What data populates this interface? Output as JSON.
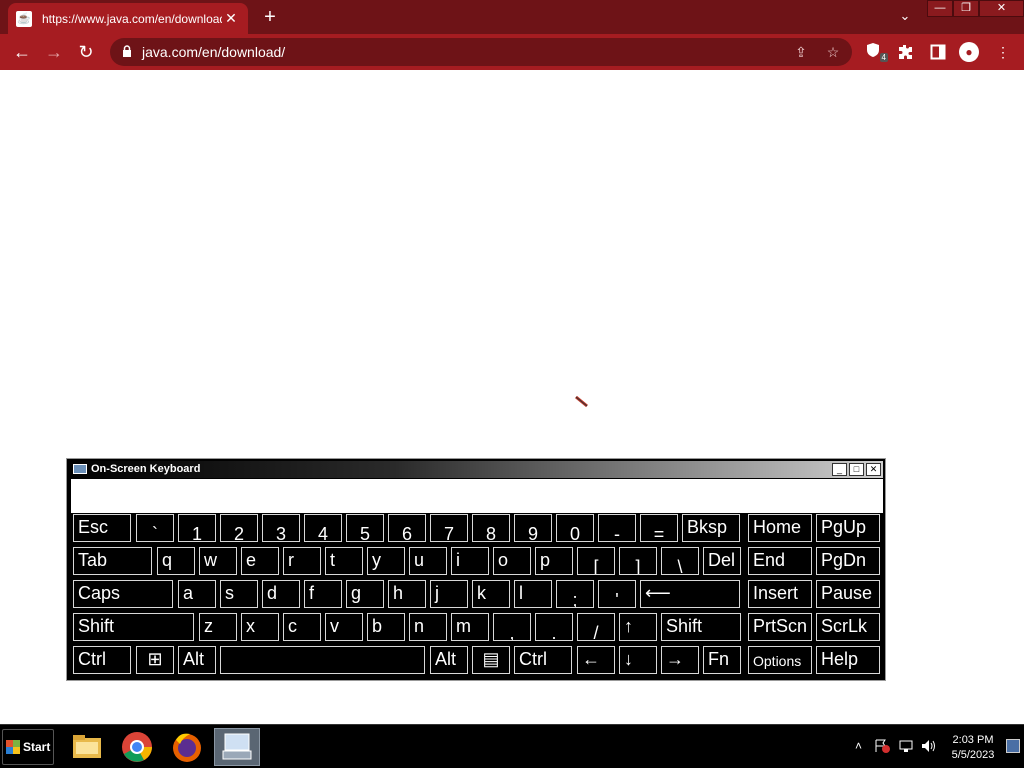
{
  "browser": {
    "tab_title": "https://www.java.com/en/download/",
    "tab_close": "✕",
    "new_tab": "+",
    "tab_search": "⌄",
    "win_min": "—",
    "win_max": "❐",
    "win_close": "✕",
    "back": "←",
    "forward": "→",
    "reload": "↻",
    "url": "java.com/en/download/",
    "extension_badge": "4"
  },
  "osk": {
    "title": "On-Screen Keyboard",
    "ctrl_min": "_",
    "ctrl_max": "□",
    "ctrl_close": "✕",
    "rows": [
      [
        "Esc",
        "`",
        "1",
        "2",
        "3",
        "4",
        "5",
        "6",
        "7",
        "8",
        "9",
        "0",
        "-",
        "=",
        "Bksp",
        "Home",
        "PgUp"
      ],
      [
        "Tab",
        "q",
        "w",
        "e",
        "r",
        "t",
        "y",
        "u",
        "i",
        "o",
        "p",
        "[",
        "]",
        "\\",
        "Del",
        "End",
        "PgDn"
      ],
      [
        "Caps",
        "a",
        "s",
        "d",
        "f",
        "g",
        "h",
        "j",
        "k",
        "l",
        ";",
        "'",
        "⟵",
        "Insert",
        "Pause"
      ],
      [
        "Shift",
        "z",
        "x",
        "c",
        "v",
        "b",
        "n",
        "m",
        ",",
        ".",
        "/",
        "↑",
        "Shift",
        "PrtScn",
        "ScrLk"
      ],
      [
        "Ctrl",
        "⊞",
        "Alt",
        "",
        "Alt",
        "▤",
        "Ctrl",
        "←",
        "↓",
        "→",
        "Fn",
        "Options",
        "Help"
      ]
    ]
  },
  "taskbar": {
    "start_label": "Start",
    "time": "2:03 PM",
    "date": "5/5/2023",
    "tray_up": "˄"
  }
}
